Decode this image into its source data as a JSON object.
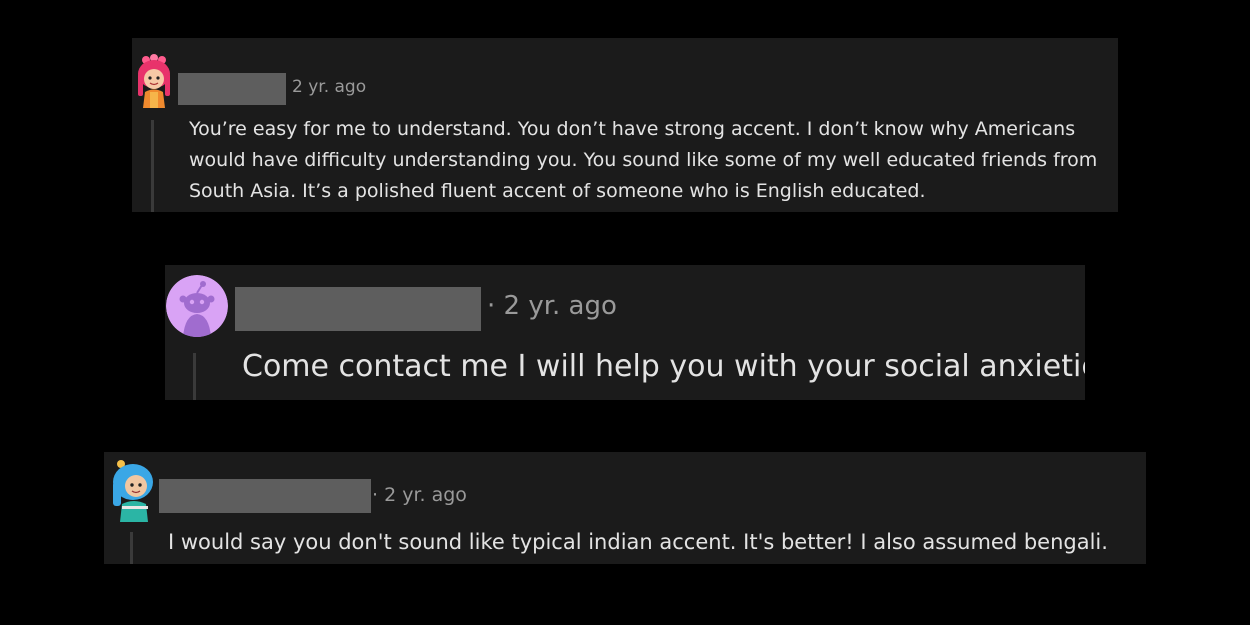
{
  "comments": [
    {
      "avatar": "pink-hair-character-avatar-icon",
      "username_redacted": true,
      "timestamp": "2 yr. ago",
      "text": "You’re easy for me to understand. You don’t have strong accent. I don’t know why Americans would have difficulty understanding you. You sound like some of my well educated friends from South Asia. It’s a polished fluent accent of someone who is English educated."
    },
    {
      "avatar": "default-snoo-avatar-icon",
      "username_redacted": true,
      "timestamp": "· 2 yr. ago",
      "text": "Come contact me I will help you with your social anxieties"
    },
    {
      "avatar": "blue-hair-character-avatar-icon",
      "username_redacted": true,
      "timestamp": "· 2 yr. ago",
      "text": "I would say you don't sound like typical indian accent. It's better! I also assumed bengali."
    }
  ],
  "colors": {
    "page_background": "#000000",
    "card_background": "#1b1b1b",
    "redaction": "#5e5e5e",
    "meta_text": "#9a9a9a",
    "body_text": "#e3e3e3"
  }
}
